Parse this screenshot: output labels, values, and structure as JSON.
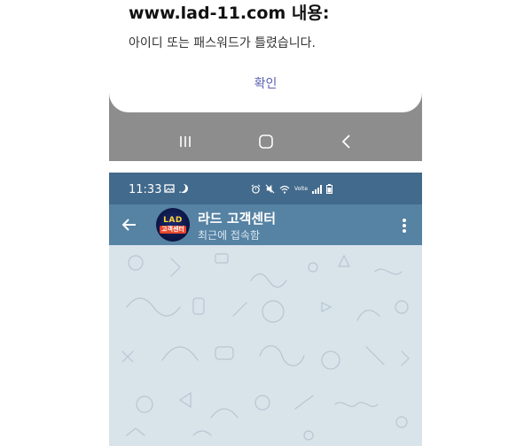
{
  "dialog": {
    "title": "www.lad-11.com 내용:",
    "message": "아이디 또는 패스워드가 틀렸습니다.",
    "ok_label": "확인"
  },
  "navbar": {
    "icons": [
      "recent-apps-icon",
      "home-icon",
      "back-icon"
    ]
  },
  "statusbar": {
    "time": "11:33",
    "icons_left": [
      "gallery-icon",
      "chat-bubble-icon"
    ],
    "icons_right": [
      "alarm-icon",
      "mute-icon",
      "wifi-icon",
      "volte-icon",
      "signal-icon",
      "battery-icon"
    ],
    "volte_text": "Volte"
  },
  "chat_header": {
    "title": "라드 고객센터",
    "subtitle": "최근에 접속함",
    "avatar_line1": "LAD",
    "avatar_line2": "고객센터"
  },
  "colors": {
    "header": "#5682a3",
    "statusbar": "#426a8c",
    "chat_bg": "#d9e3ea",
    "dialog_button": "#5b5fb0",
    "navbar": "#8d8d8d"
  }
}
